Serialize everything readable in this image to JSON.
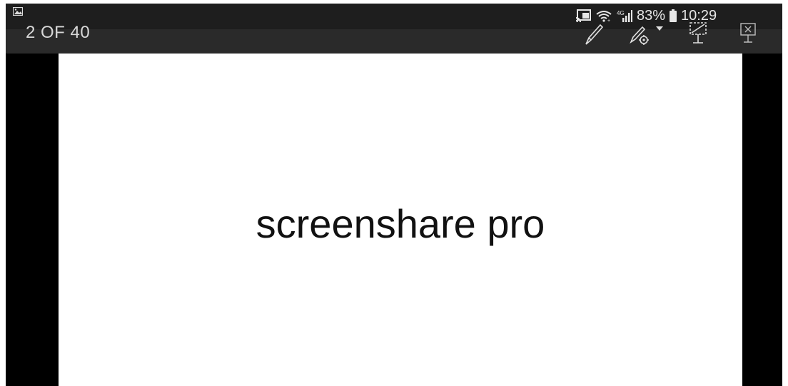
{
  "status_bar": {
    "battery_percent": "83%",
    "time": "10:29",
    "network_label": "4G",
    "icons": [
      "cast-icon",
      "wifi-icon",
      "signal-icon",
      "battery-icon"
    ]
  },
  "toolbar": {
    "slide_counter": "2 OF 40",
    "tools": [
      "pen-icon",
      "pen-settings-icon",
      "dropdown-arrow-icon",
      "laser-pointer-icon",
      "end-slideshow-icon"
    ]
  },
  "slide": {
    "title": "screenshare pro",
    "background": "#ffffff",
    "text_color": "#111111"
  },
  "colors": {
    "letterbox": "#000000",
    "toolbar": "#2a2a2a",
    "status_text": "#e6e6e6"
  }
}
